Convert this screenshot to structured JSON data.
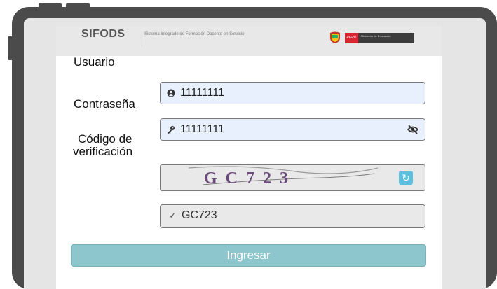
{
  "header": {
    "brand": "SIFODS",
    "subtitle": "Sistema Integrado de Formación Docente en Servicio",
    "gov_country": "PERÚ",
    "gov_ministry": "Ministerio de Educación"
  },
  "form": {
    "usuario_label": "Usuario",
    "contrasena_label": "Contraseña",
    "codigo_label_line1": "Código de",
    "codigo_label_line2": "verificación",
    "usuario_value": "11111111",
    "contrasena_value": "11111111",
    "captcha_text": "GC723",
    "captcha_input_value": "GC723",
    "submit_label": "Ingresar"
  },
  "icons": {
    "user": "user-circle-icon",
    "key": "key-icon",
    "eye": "eye-slash-icon",
    "refresh": "refresh-icon",
    "check": "check-icon"
  },
  "colors": {
    "frame": "#4b4b4b",
    "field_active": "#e8f0fe",
    "submit": "#8dc6cd",
    "refresh": "#5bc0de"
  }
}
